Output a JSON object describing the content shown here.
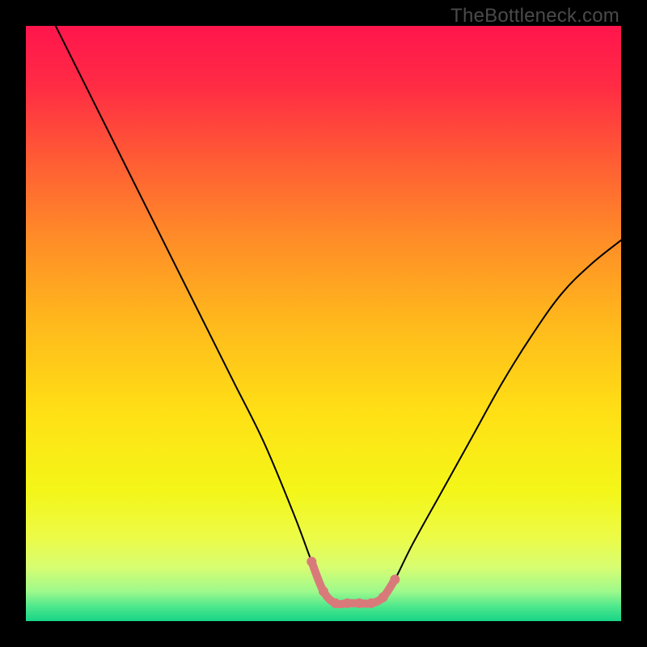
{
  "watermark": "TheBottleneck.com",
  "gradient": {
    "stops": [
      {
        "offset": 0.0,
        "color": "#ff154d"
      },
      {
        "offset": 0.1,
        "color": "#ff2b44"
      },
      {
        "offset": 0.22,
        "color": "#ff5a35"
      },
      {
        "offset": 0.35,
        "color": "#ff8a28"
      },
      {
        "offset": 0.5,
        "color": "#ffb91c"
      },
      {
        "offset": 0.65,
        "color": "#ffe015"
      },
      {
        "offset": 0.78,
        "color": "#f4f618"
      },
      {
        "offset": 0.86,
        "color": "#ecfb47"
      },
      {
        "offset": 0.91,
        "color": "#d7fd72"
      },
      {
        "offset": 0.95,
        "color": "#9ef98c"
      },
      {
        "offset": 0.975,
        "color": "#4fe88c"
      },
      {
        "offset": 1.0,
        "color": "#17d487"
      }
    ]
  },
  "chart_data": {
    "type": "line",
    "title": "",
    "xlabel": "",
    "ylabel": "",
    "xlim": [
      0,
      100
    ],
    "ylim": [
      0,
      100
    ],
    "series": [
      {
        "name": "bottleneck-curve",
        "color": "#000000",
        "x": [
          5,
          10,
          15,
          20,
          25,
          30,
          35,
          40,
          45,
          48,
          50,
          52,
          54,
          56,
          58,
          60,
          62,
          65,
          70,
          75,
          80,
          85,
          90,
          95,
          100
        ],
        "y": [
          100,
          90,
          80,
          70,
          60,
          50,
          40,
          30,
          18,
          10,
          5,
          3,
          3,
          3,
          3,
          4,
          7,
          13,
          22,
          31,
          40,
          48,
          55,
          60,
          64
        ]
      },
      {
        "name": "bottom-highlight",
        "color": "#d97a7a",
        "x": [
          48,
          50,
          52,
          54,
          56,
          58,
          60,
          62
        ],
        "y": [
          10,
          5,
          3,
          3,
          3,
          3,
          4,
          7
        ]
      }
    ]
  }
}
